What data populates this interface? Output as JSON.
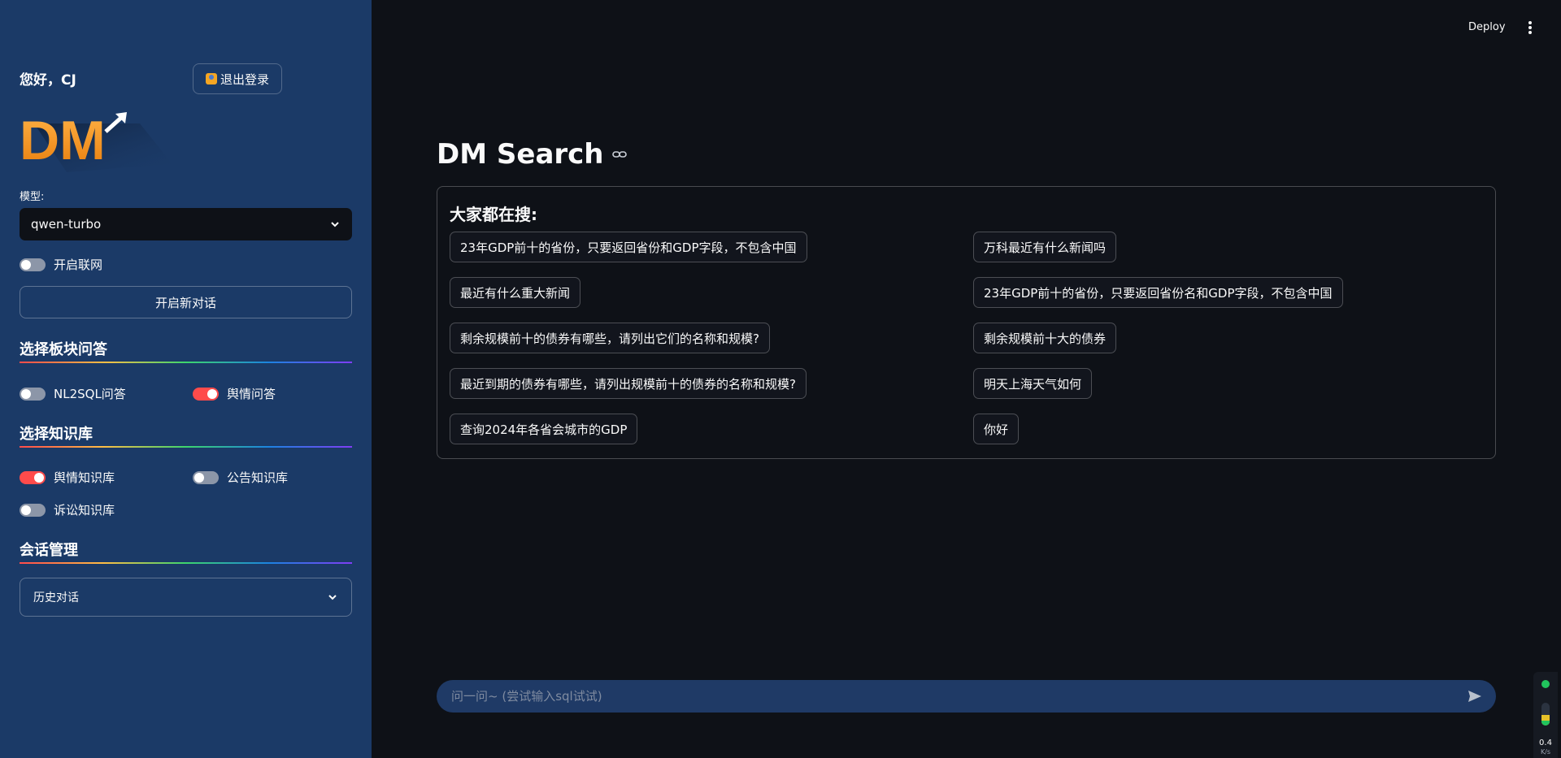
{
  "sidebar": {
    "greeting": "您好，CJ",
    "logout_label": "退出登录",
    "logo_text": "DM",
    "model_label": "模型:",
    "model_value": "qwen-turbo",
    "web_toggle": {
      "label": "开启联网",
      "on": false
    },
    "new_chat_label": "开启新对话",
    "section_qa": "选择板块问答",
    "qa_toggles": [
      {
        "label": "NL2SQL问答",
        "on": false
      },
      {
        "label": "舆情问答",
        "on": true
      }
    ],
    "section_kb": "选择知识库",
    "kb_toggles": [
      {
        "label": "舆情知识库",
        "on": true
      },
      {
        "label": "公告知识库",
        "on": false
      },
      {
        "label": "诉讼知识库",
        "on": false
      }
    ],
    "section_session": "会话管理",
    "history_label": "历史对话"
  },
  "header": {
    "deploy_label": "Deploy"
  },
  "main": {
    "title": "DM Search",
    "suggest_title": "大家都在搜:",
    "suggestions_left": [
      "23年GDP前十的省份，只要返回省份和GDP字段，不包含中国",
      "最近有什么重大新闻",
      "剩余规模前十的债券有哪些，请列出它们的名称和规模?",
      "最近到期的债券有哪些，请列出规模前十的债券的名称和规模?",
      "查询2024年各省会城市的GDP"
    ],
    "suggestions_right": [
      "万科最近有什么新闻吗",
      "23年GDP前十的省份，只要返回省份名和GDP字段，不包含中国",
      "剩余规模前十大的债券",
      "明天上海天气如何",
      "你好"
    ],
    "chat_placeholder": "问一问~ (尝试输入sql试试)"
  },
  "status_widget": {
    "speed_value": "0.4",
    "speed_unit": "K/s"
  },
  "colors": {
    "sidebar_bg": "#1b3a67",
    "main_bg": "#0e1117",
    "toggle_on": "#ff4b4b",
    "logo_orange": "#f7941d"
  }
}
